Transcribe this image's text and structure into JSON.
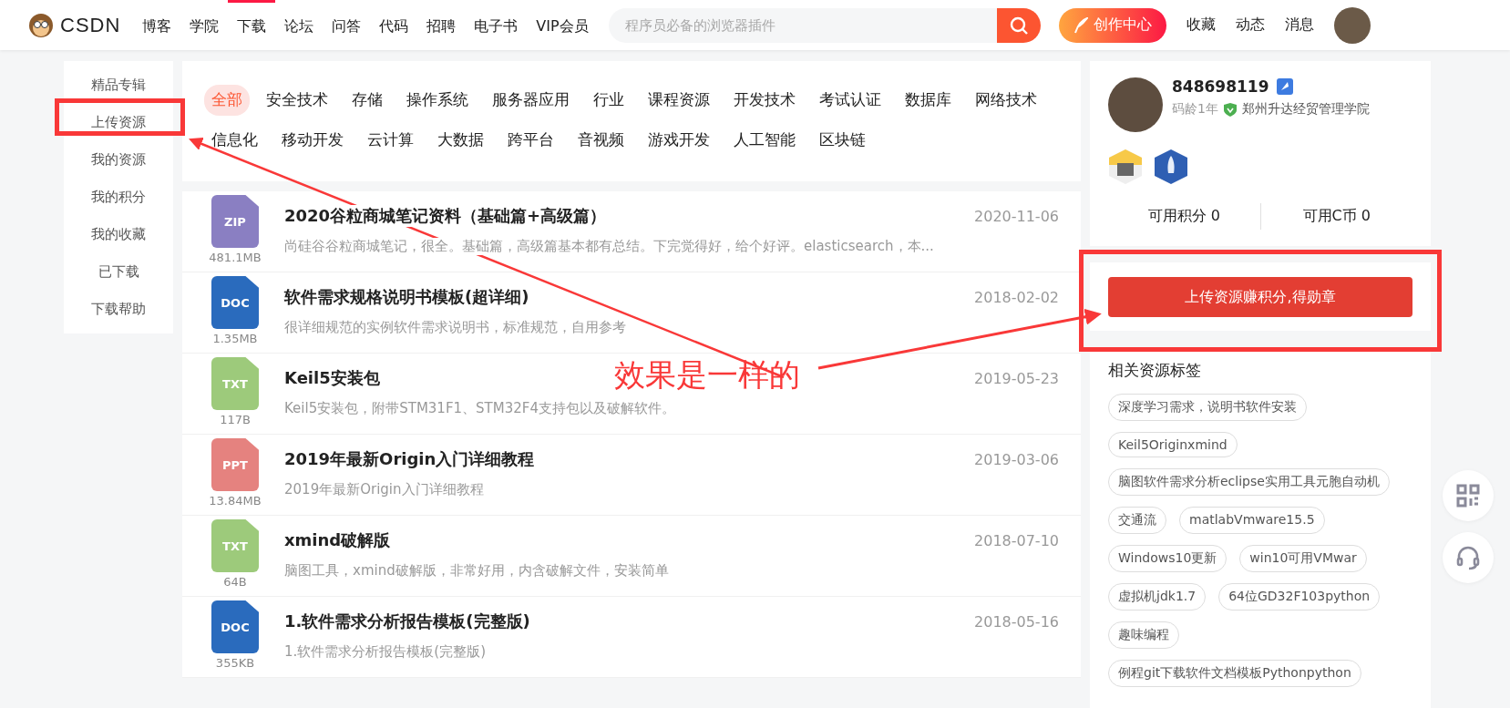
{
  "header": {
    "logo_text": "CSDN",
    "nav": [
      {
        "label": "博客",
        "selected": false
      },
      {
        "label": "学院",
        "selected": false
      },
      {
        "label": "下载",
        "selected": true
      },
      {
        "label": "论坛",
        "selected": false
      },
      {
        "label": "问答",
        "selected": false
      },
      {
        "label": "代码",
        "selected": false
      },
      {
        "label": "招聘",
        "selected": false
      },
      {
        "label": "电子书",
        "selected": false
      },
      {
        "label": "VIP会员",
        "selected": false
      }
    ],
    "search": {
      "placeholder": "程序员必备的浏览器插件"
    },
    "create_button": "创作中心",
    "links": [
      "收藏",
      "动态",
      "消息"
    ]
  },
  "sidebar": {
    "items": [
      "精品专辑",
      "上传资源",
      "我的资源",
      "我的积分",
      "我的收藏",
      "已下载",
      "下载帮助"
    ]
  },
  "categories": [
    {
      "label": "全部",
      "selected": true
    },
    {
      "label": "安全技术",
      "selected": false
    },
    {
      "label": "存储",
      "selected": false
    },
    {
      "label": "操作系统",
      "selected": false
    },
    {
      "label": "服务器应用",
      "selected": false
    },
    {
      "label": "行业",
      "selected": false
    },
    {
      "label": "课程资源",
      "selected": false
    },
    {
      "label": "开发技术",
      "selected": false
    },
    {
      "label": "考试认证",
      "selected": false
    },
    {
      "label": "数据库",
      "selected": false
    },
    {
      "label": "网络技术",
      "selected": false
    },
    {
      "label": "信息化",
      "selected": false
    },
    {
      "label": "移动开发",
      "selected": false
    },
    {
      "label": "云计算",
      "selected": false
    },
    {
      "label": "大数据",
      "selected": false
    },
    {
      "label": "跨平台",
      "selected": false
    },
    {
      "label": "音视频",
      "selected": false
    },
    {
      "label": "游戏开发",
      "selected": false
    },
    {
      "label": "人工智能",
      "selected": false
    },
    {
      "label": "区块链",
      "selected": false
    }
  ],
  "resources": [
    {
      "kind": "zip",
      "type": "ZIP",
      "size": "481.1MB",
      "title": "2020谷粒商城笔记资料（基础篇+高级篇）",
      "description": "尚硅谷谷粒商城笔记，很全。基础篇，高级篇基本都有总结。下完觉得好，给个好评。elasticsearch，本...",
      "date": "2020-11-06"
    },
    {
      "kind": "doc",
      "type": "DOC",
      "size": "1.35MB",
      "title": "软件需求规格说明书模板(超详细)",
      "description": "很详细规范的实例软件需求说明书，标准规范，自用参考",
      "date": "2018-02-02"
    },
    {
      "kind": "txt",
      "type": "TXT",
      "size": "117B",
      "title": "Keil5安装包",
      "description": "Keil5安装包，附带STM31F1、STM32F4支持包以及破解软件。",
      "date": "2019-05-23"
    },
    {
      "kind": "ppt",
      "type": "PPT",
      "size": "13.84MB",
      "title": "2019年最新Origin入门详细教程",
      "description": "2019年最新Origin入门详细教程",
      "date": "2019-03-06"
    },
    {
      "kind": "txt",
      "type": "TXT",
      "size": "64B",
      "title": "xmind破解版",
      "description": "脑图工具，xmind破解版，非常好用，内含破解文件，安装简单",
      "date": "2018-07-10"
    },
    {
      "kind": "doc",
      "type": "DOC",
      "size": "355KB",
      "title": "1.软件需求分析报告模板(完整版)",
      "description": "1.软件需求分析报告模板(完整版)",
      "date": "2018-05-16"
    }
  ],
  "profile": {
    "username": "848698119",
    "age": "码龄1年",
    "school": "郑州升达经贸管理学院",
    "points": "可用积分 0",
    "coins": "可用C币 0"
  },
  "upload_button": "上传资源赚积分,得勋章",
  "tags_title": "相关资源标签",
  "tags": [
    "深度学习需求，说明书软件安装",
    "Keil5Originxmind",
    "脑图软件需求分析eclipse实用工具元胞自动机",
    "交通流",
    "matlabVmware15.5",
    "Windows10更新",
    "win10可用VMwar",
    "虚拟机jdk1.7",
    "64位GD32F103python",
    "趣味编程",
    "例程git下载软件文档模板Pythonpython"
  ],
  "annotation": {
    "text": "效果是一样的"
  }
}
